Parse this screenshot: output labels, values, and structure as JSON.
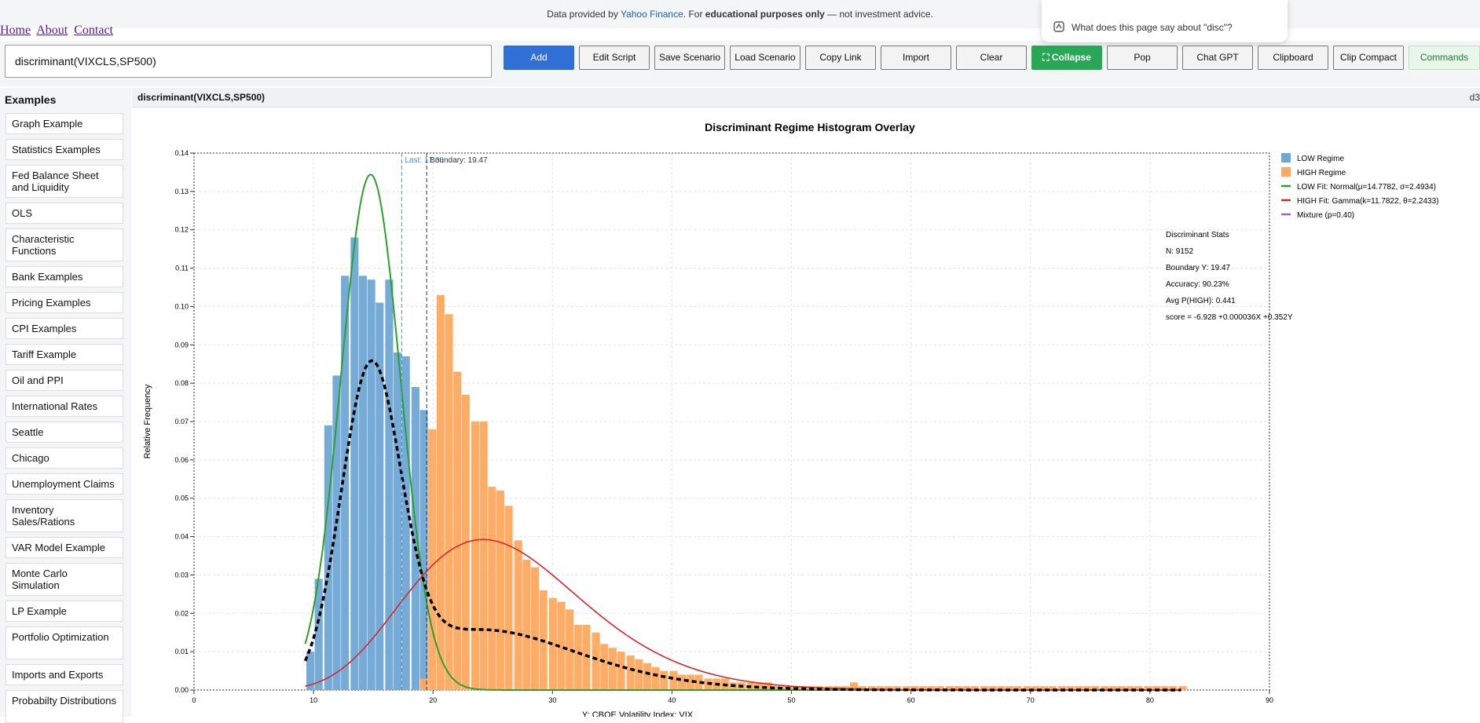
{
  "notice": {
    "prefix": "Data provided by ",
    "link": "Yahoo Finance",
    "middle": ". For ",
    "bold": "educational purposes only",
    "suffix": " — not investment advice."
  },
  "popup": {
    "text": "What does this page say about \"disc\"?",
    "icon": "copilot-icon"
  },
  "nav": {
    "home": "Home",
    "about": "About",
    "contact": "Contact"
  },
  "input": {
    "value": "discriminant(VIXCLS,SP500)"
  },
  "toolbar": [
    {
      "label": "Add",
      "style": "blue"
    },
    {
      "label": "Edit Script",
      "style": ""
    },
    {
      "label": "Save Scenario",
      "style": ""
    },
    {
      "label": "Load Scenario",
      "style": ""
    },
    {
      "label": "Copy Link",
      "style": ""
    },
    {
      "label": "Import",
      "style": ""
    },
    {
      "label": "Clear",
      "style": ""
    },
    {
      "label": "⛶ Collapse",
      "style": "green"
    },
    {
      "label": "Pop",
      "style": ""
    },
    {
      "label": "Chat GPT",
      "style": ""
    },
    {
      "label": "Clipboard",
      "style": ""
    },
    {
      "label": "Clip Compact",
      "style": ""
    },
    {
      "label": "Commands",
      "style": "lgreen"
    }
  ],
  "sidebar": {
    "header": "Examples",
    "items": [
      "Graph Example",
      "Statistics Examples",
      "Fed Balance Sheet and Liquidity",
      "OLS",
      "Characteristic Functions",
      "Bank Examples",
      "Pricing Examples",
      "CPI Examples",
      "Tariff Example",
      "Oil and PPI",
      "International Rates",
      "Seattle",
      "Chicago",
      "Unemployment Claims",
      "Inventory Sales/Rations",
      "VAR Model Example",
      "Monte Carlo Simulation",
      "LP Example",
      "Portfolio Optimization",
      "Imports and Exports",
      "Probabilty Distributions"
    ]
  },
  "main": {
    "title": "discriminant(VIXCLS,SP500)",
    "right_text": "d3"
  },
  "chart_data": {
    "type": "bar",
    "title": "Discriminant Regime Histogram Overlay",
    "ylabel": "Relative Frequency",
    "xlabel": "Y: CBOE Volatility Index: VIX",
    "xlim": [
      0,
      90
    ],
    "ylim": [
      0,
      0.14
    ],
    "xticks": [
      "0",
      "10",
      "20",
      "30",
      "40",
      "50",
      "60",
      "70",
      "80",
      "90"
    ],
    "yticks": [
      "0.00",
      "0.01",
      "0.02",
      "0.03",
      "0.04",
      "0.05",
      "0.06",
      "0.07",
      "0.08",
      "0.09",
      "0.10",
      "0.11",
      "0.12",
      "0.13",
      "0.14"
    ],
    "grid": true,
    "legend_position": "top-right",
    "bin_width": 0.73,
    "series": [
      {
        "name": "LOW Regime",
        "color": "#6ea6d4",
        "x": [
          9.4,
          10.1,
          10.9,
          11.6,
          12.3,
          13.1,
          13.8,
          14.5,
          15.2,
          16.0,
          16.7,
          17.4,
          18.2,
          18.9
        ],
        "values": [
          0.01,
          0.029,
          0.069,
          0.082,
          0.108,
          0.118,
          0.108,
          0.107,
          0.101,
          0.107,
          0.088,
          0.087,
          0.079,
          0.073
        ]
      },
      {
        "name": "HIGH Regime",
        "color": "#ffa95e",
        "x": [
          18.9,
          19.6,
          20.3,
          21.0,
          21.7,
          22.4,
          23.2,
          23.9,
          24.6,
          25.3,
          26.0,
          26.8,
          27.5,
          28.2,
          28.9,
          29.7,
          30.4,
          31.1,
          31.8,
          32.5,
          33.3,
          34.0,
          34.7,
          35.4,
          36.2,
          36.9,
          37.6,
          38.3,
          39.0,
          39.8,
          40.5,
          41.2,
          41.9,
          42.7,
          43.4,
          44.1,
          44.8,
          45.5,
          46.3,
          47.0,
          47.7,
          48.4,
          49.2,
          49.9,
          50.6,
          51.3,
          52.0,
          52.8,
          53.5,
          54.2,
          54.9,
          55.6,
          56.4,
          57.1,
          57.8,
          58.5,
          59.3,
          60.0,
          60.7,
          61.4,
          62.1,
          62.9,
          63.6,
          64.3,
          65.0,
          65.8,
          66.5,
          67.2,
          67.9,
          68.6,
          69.4,
          70.1,
          70.8,
          71.5,
          72.3,
          73.0,
          73.7,
          74.4,
          75.1,
          75.9,
          76.6,
          77.3,
          78.0,
          78.7,
          79.5,
          80.2,
          80.9,
          81.6,
          82.4
        ],
        "values": [
          0.003,
          0.068,
          0.103,
          0.098,
          0.083,
          0.077,
          0.07,
          0.07,
          0.053,
          0.052,
          0.048,
          0.039,
          0.034,
          0.032,
          0.026,
          0.024,
          0.023,
          0.021,
          0.017,
          0.017,
          0.015,
          0.012,
          0.011,
          0.01,
          0.009,
          0.008,
          0.007,
          0.006,
          0.005,
          0.005,
          0.004,
          0.004,
          0.004,
          0.003,
          0.003,
          0.003,
          0.002,
          0.002,
          0.002,
          0.002,
          0.002,
          0.001,
          0.001,
          0.001,
          0.001,
          0.001,
          0.001,
          0.001,
          0.001,
          0.001,
          0.002,
          0.001,
          0.001,
          0.001,
          0.001,
          0.001,
          0.001,
          0.001,
          0.001,
          0.001,
          0.001,
          0.001,
          0.001,
          0.001,
          0.001,
          0.001,
          0.001,
          0.001,
          0.001,
          0.001,
          0.001,
          0.001,
          0.001,
          0.001,
          0.001,
          0.001,
          0.001,
          0.001,
          0.001,
          0.001,
          0.001,
          0.001,
          0.001,
          0.001,
          0.001,
          0.001,
          0.001,
          0.001,
          0.001
        ]
      },
      {
        "name": "LOW Fit: Normal(μ=14.7782, σ=2.4934)",
        "color": "#2ca02c",
        "fit": "normal",
        "mu": 14.7782,
        "sigma": 2.4934,
        "scale": 0.84
      },
      {
        "name": "HIGH Fit: Gamma(k=11.7822, θ=2.2433)",
        "color": "#d62728",
        "fit": "gamma",
        "k": 11.7822,
        "theta": 2.2433,
        "scale": 0.73
      },
      {
        "name": "Mixture (p=0.40)",
        "color": "#000000",
        "legend_color": "#9467bd",
        "fit": "mixture",
        "p": 0.4
      }
    ],
    "reference_lines": [
      {
        "label": "Last: 17.38",
        "x": 17.38,
        "color": "#4a90c8"
      },
      {
        "label": "Boundary: 19.47",
        "x": 19.47,
        "color": "#333333"
      }
    ],
    "stats": {
      "title": "Discriminant Stats",
      "lines": [
        "N: 9152",
        "Boundary Y: 19.47",
        "Accuracy: 90.23%",
        "Avg P(HIGH): 0.441",
        "score = -6.928 +0.000036X +0.352Y"
      ]
    }
  }
}
